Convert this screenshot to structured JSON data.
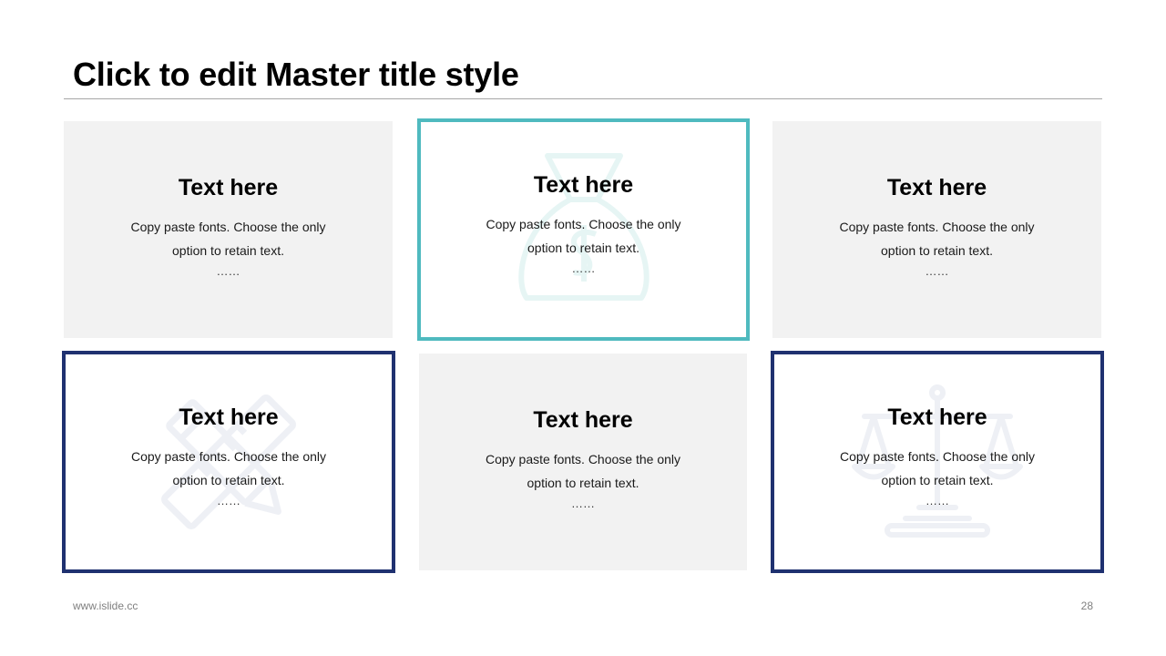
{
  "slide": {
    "title": "Click to edit Master title style",
    "footer_url": "www.islide.cc",
    "page_number": "28"
  },
  "colors": {
    "gray_fill": "#f2f2f2",
    "teal_border": "#4fbabf",
    "navy_border": "#1f3170"
  },
  "cards": [
    {
      "heading": "Text here",
      "line1": "Copy paste fonts. Choose the only",
      "line2": "option to retain text.",
      "dots": "……",
      "style": "gray"
    },
    {
      "heading": "Text here",
      "line1": "Copy paste fonts. Choose the only",
      "line2": "option to retain text.",
      "dots": "……",
      "style": "teal",
      "watermark_icon": "money-bag-icon"
    },
    {
      "heading": "Text here",
      "line1": "Copy paste fonts. Choose the only",
      "line2": "option to retain text.",
      "dots": "……",
      "style": "gray"
    },
    {
      "heading": "Text here",
      "line1": "Copy paste fonts. Choose the only",
      "line2": "option to retain text.",
      "dots": "……",
      "style": "navy",
      "watermark_icon": "ruler-pencil-icon"
    },
    {
      "heading": "Text here",
      "line1": "Copy paste fonts. Choose the only",
      "line2": "option to retain text.",
      "dots": "……",
      "style": "gray"
    },
    {
      "heading": "Text here",
      "line1": "Copy paste fonts. Choose the only",
      "line2": "option to retain text.",
      "dots": "……",
      "style": "navy",
      "watermark_icon": "scales-of-justice-icon"
    }
  ]
}
